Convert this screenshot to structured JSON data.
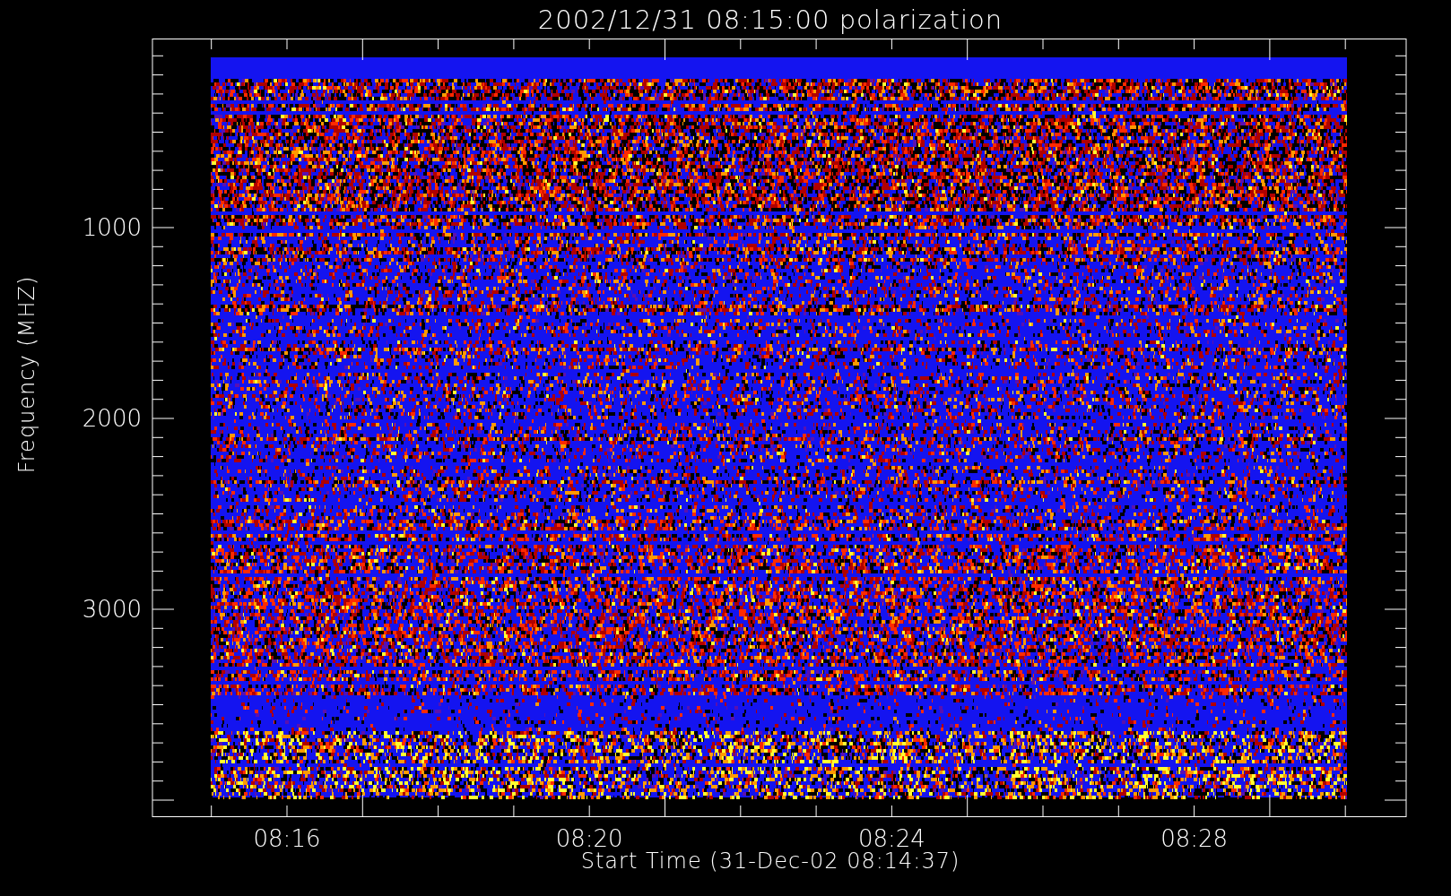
{
  "title": "2002/12/31 08:15:00 polarization",
  "y_axis": {
    "label": "Frequency (MHZ)",
    "ticks": [
      "1000",
      "2000",
      "3000"
    ]
  },
  "x_axis": {
    "label": "Start Time (31-Dec-02 08:14:37)",
    "ticks": [
      "08:16",
      "08:20",
      "08:24",
      "08:28"
    ]
  }
}
